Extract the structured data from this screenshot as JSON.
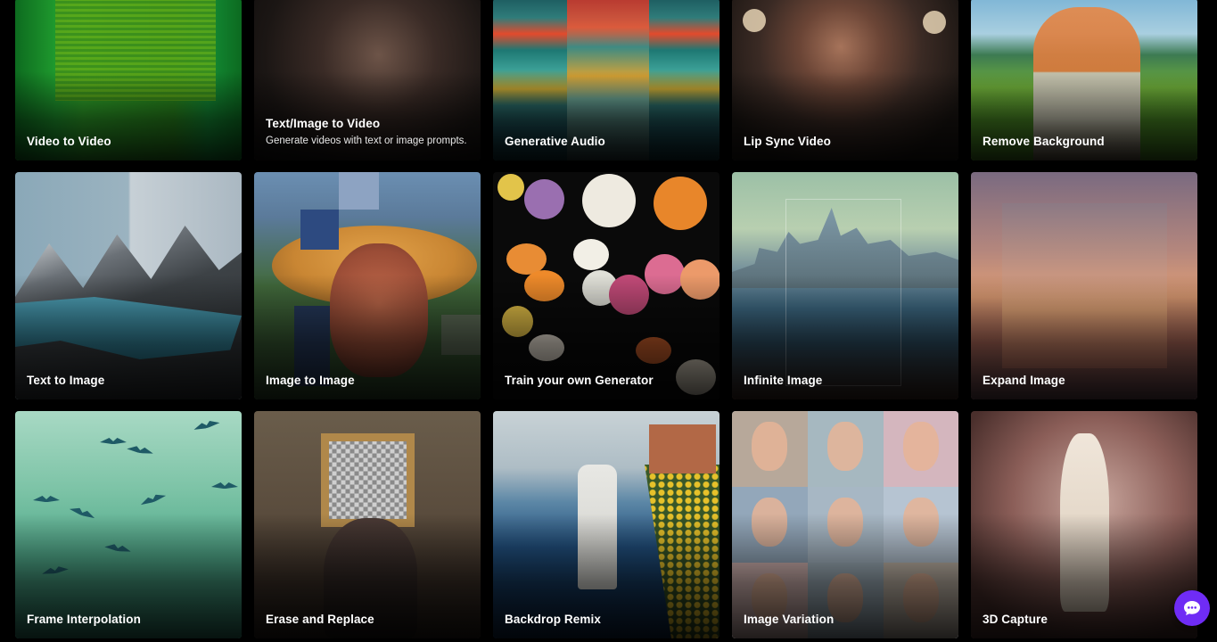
{
  "cards": [
    {
      "title": "Video to Video",
      "description": ""
    },
    {
      "title": "Text/Image to Video",
      "description": "Generate videos with text or image prompts."
    },
    {
      "title": "Generative Audio",
      "description": ""
    },
    {
      "title": "Lip Sync Video",
      "description": ""
    },
    {
      "title": "Remove Background",
      "description": ""
    },
    {
      "title": "Text to Image",
      "description": ""
    },
    {
      "title": "Image to Image",
      "description": ""
    },
    {
      "title": "Train your own Generator",
      "description": ""
    },
    {
      "title": "Infinite Image",
      "description": ""
    },
    {
      "title": "Expand Image",
      "description": ""
    },
    {
      "title": "Frame Interpolation",
      "description": ""
    },
    {
      "title": "Erase and Replace",
      "description": ""
    },
    {
      "title": "Backdrop Remix",
      "description": ""
    },
    {
      "title": "Image Variation",
      "description": ""
    },
    {
      "title": "3D Capture",
      "description": ""
    }
  ],
  "chat_button": {
    "icon": "chat-bubble-icon",
    "color": "#6f2cf5"
  }
}
